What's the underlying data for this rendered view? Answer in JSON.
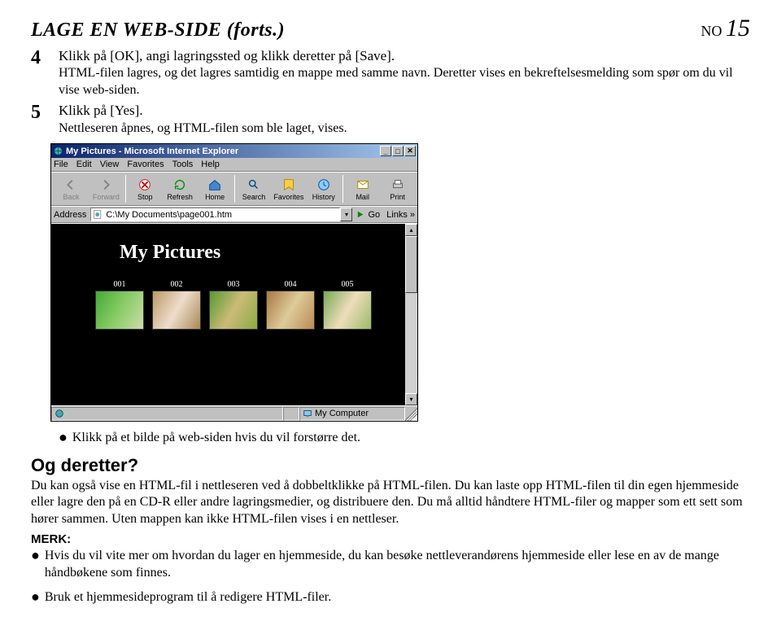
{
  "header": {
    "title": "LAGE EN WEB-SIDE (forts.)",
    "lang": "NO",
    "page_number": "15"
  },
  "steps": [
    {
      "num": "4",
      "lead": "Klikk på [OK], angi lagringssted og klikk deretter på [Save].",
      "rest": "HTML-filen lagres, og det lagres samtidig en mappe med samme navn. Deretter vises en bekreftelsesmelding som spør om du vil vise web-siden."
    },
    {
      "num": "5",
      "lead": "Klikk på [Yes].",
      "rest": "Nettleseren åpnes, og HTML-filen som ble laget, vises."
    }
  ],
  "browser": {
    "title": "My Pictures - Microsoft Internet Explorer",
    "menu": [
      "File",
      "Edit",
      "View",
      "Favorites",
      "Tools",
      "Help"
    ],
    "toolbar": [
      {
        "label": "Back",
        "disabled": true
      },
      {
        "label": "Forward",
        "disabled": true
      },
      {
        "label": "Stop",
        "disabled": false
      },
      {
        "label": "Refresh",
        "disabled": false
      },
      {
        "label": "Home",
        "disabled": false
      },
      {
        "label": "Search",
        "disabled": false
      },
      {
        "label": "Favorites",
        "disabled": false
      },
      {
        "label": "History",
        "disabled": false
      },
      {
        "label": "Mail",
        "disabled": false
      },
      {
        "label": "Print",
        "disabled": false
      }
    ],
    "address_label": "Address",
    "address_value": "C:\\My Documents\\page001.htm",
    "go_label": "Go",
    "links_label": "Links »",
    "page_heading": "My Pictures",
    "thumbnails": [
      "001",
      "002",
      "003",
      "004",
      "005"
    ],
    "status_zone": "My Computer"
  },
  "bullet_after_browser": "Klikk på et bilde på web-siden hvis du vil forstørre det.",
  "og_deretter": {
    "heading": "Og deretter?",
    "para": "Du kan også vise en HTML-fil i nettleseren ved å dobbeltklikke på HTML-filen. Du kan laste opp HTML-filen til din egen hjemmeside eller lagre den på en CD-R eller andre lagringsmedier, og distribuere den. Du må alltid håndtere HTML-filer og mapper som ett sett som hører sammen. Uten mappen kan ikke HTML-filen vises i en nettleser."
  },
  "merk": {
    "heading": "MERK:",
    "items": [
      "Hvis du vil vite mer om hvordan du lager en hjemmeside, du kan besøke nettleverandørens hjemmeside eller lese en av de mange håndbøkene som finnes.",
      "Bruk et hjemmesideprogram til å redigere HTML-filer."
    ]
  }
}
